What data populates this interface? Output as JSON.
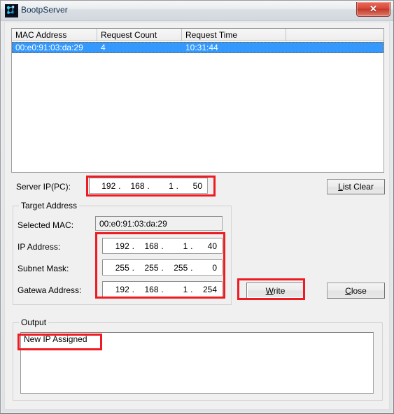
{
  "window": {
    "title": "BootpServer",
    "icon": "app-icon",
    "close_label": "✕"
  },
  "list": {
    "columns": [
      "MAC Address",
      "Request Count",
      "Request Time",
      ""
    ],
    "rows": [
      {
        "mac": "00:e0:91:03:da:29",
        "request_count": "4",
        "request_time": "10:31:44",
        "extra": "",
        "selected": true
      }
    ]
  },
  "server_ip": {
    "label": "Server IP(PC):",
    "octets": [
      "192",
      "168",
      "1",
      "50"
    ],
    "separator": "."
  },
  "target_address": {
    "group_title": "Target Address",
    "selected_mac_label": "Selected MAC:",
    "selected_mac_value": "00:e0:91:03:da:29",
    "ip_label": "IP Address:",
    "ip_octets": [
      "192",
      "168",
      "1",
      "40"
    ],
    "subnet_label": "Subnet Mask:",
    "subnet_octets": [
      "255",
      "255",
      "255",
      "0"
    ],
    "gateway_label": "Gatewa Address:",
    "gateway_octets": [
      "192",
      "168",
      "1",
      "254"
    ],
    "separator": "."
  },
  "buttons": {
    "list_clear": {
      "pre": "",
      "mnemonic": "L",
      "post": "ist Clear"
    },
    "write": {
      "pre": "",
      "mnemonic": "W",
      "post": "rite"
    },
    "close": {
      "pre": "",
      "mnemonic": "C",
      "post": "lose"
    }
  },
  "output": {
    "group_title": "Output",
    "lines": [
      "New IP Assigned"
    ]
  },
  "colors": {
    "selection_blue": "#3399ff",
    "annotation_red": "#ee1c22",
    "close_button_red": "#d94a3a",
    "window_bg": "#f0f0f0"
  }
}
